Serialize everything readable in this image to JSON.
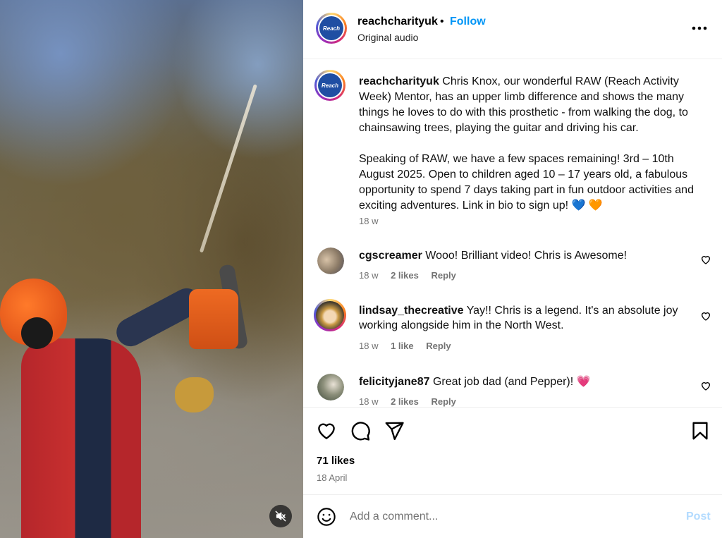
{
  "post": {
    "username": "reachcharityuk",
    "separator": "•",
    "follow_label": "Follow",
    "audio": "Original audio",
    "avatar_logo_text": "Reach",
    "more_icon": "more-horizontal-icon",
    "video_mute_icon": "sound-off-icon"
  },
  "caption": {
    "username": "reachcharityuk",
    "paragraph1": "Chris Knox, our wonderful RAW (Reach Activity Week) Mentor, has an upper limb difference and shows the many things he loves to do with this prosthetic - from walking the dog, to chainsawing trees, playing the guitar and driving his car.",
    "paragraph2": "Speaking of RAW, we have a few spaces remaining! 3rd – 10th August 2025. Open to children aged 10 – 17 years old, a fabulous opportunity to spend 7 days taking part in fun outdoor activities and exciting adventures. Link in bio to sign up! 💙 🧡",
    "time": "18 w"
  },
  "comments": [
    {
      "username": "cgscreamer",
      "text": "Wooo! Brilliant video! Chris is Awesome!",
      "time": "18 w",
      "likes": "2 likes",
      "reply": "Reply"
    },
    {
      "username": "lindsay_thecreative",
      "text": "Yay!! Chris is a legend. It's an absolute joy working alongside him in the North West.",
      "time": "18 w",
      "likes": "1 like",
      "reply": "Reply"
    },
    {
      "username": "felicityjane87",
      "text": "Great job dad (and Pepper)! 💗",
      "time": "18 w",
      "likes": "2 likes",
      "reply": "Reply"
    }
  ],
  "actions": {
    "likes": "71 likes",
    "date": "18 April",
    "icons": [
      "heart-icon",
      "comment-icon",
      "share-icon",
      "bookmark-icon"
    ]
  },
  "add_comment": {
    "placeholder": "Add a comment...",
    "post_label": "Post",
    "post_color": "#b3dbff"
  },
  "colors": {
    "link_blue": "#0095f6",
    "muted_text": "#737373",
    "border": "#efefef"
  }
}
